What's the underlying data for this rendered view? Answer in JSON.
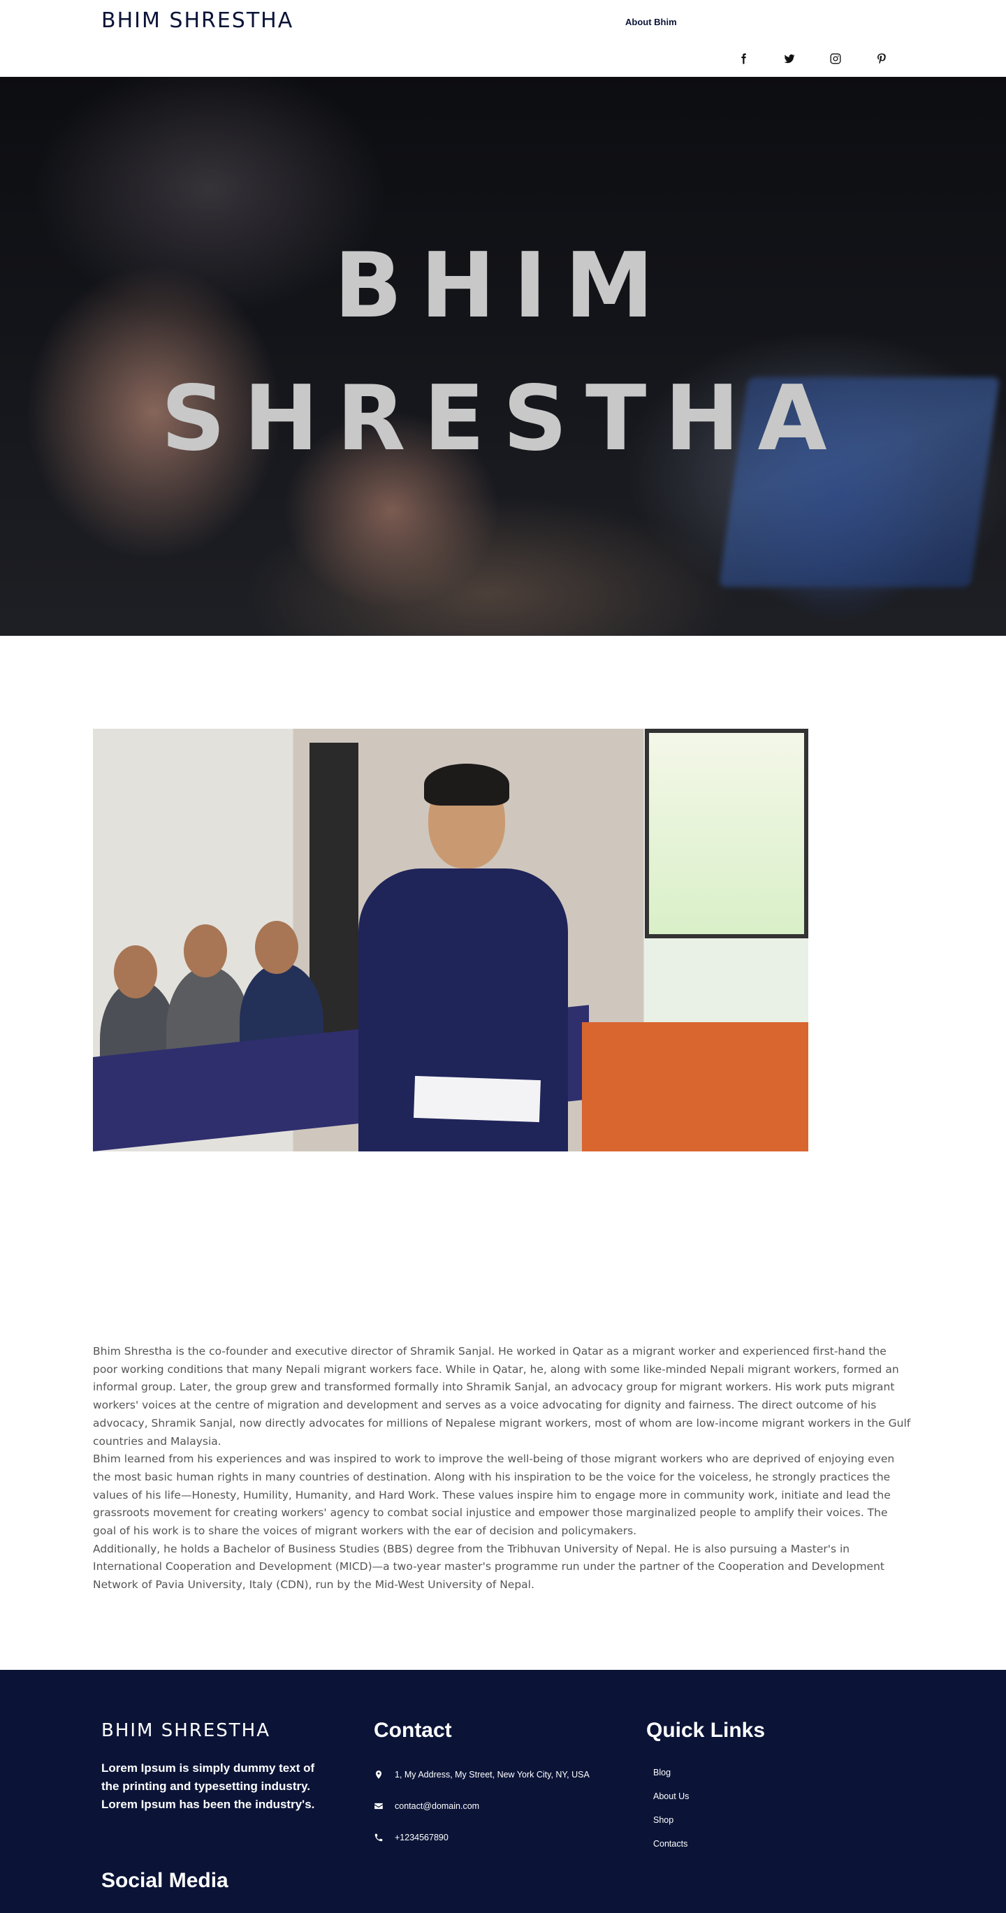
{
  "header": {
    "brand": "BHIM SHRESTHA",
    "nav": [
      {
        "label": "About Bhim"
      }
    ],
    "social": [
      "facebook-icon",
      "twitter-icon",
      "instagram-icon",
      "pinterest-icon"
    ]
  },
  "hero": {
    "line1": "BHIM",
    "line2": "SHRESTHA"
  },
  "bio": {
    "paragraphs": [
      "Bhim Shrestha is the co-founder and executive director of Shramik Sanjal. He worked in Qatar as a migrant worker and experienced first-hand the poor working conditions that many Nepali migrant workers face. While in Qatar, he, along with some like-minded Nepali migrant workers, formed an informal group. Later, the group grew and transformed formally into Shramik Sanjal, an advocacy group for migrant workers. His work puts migrant workers' voices at the centre of migration and development and serves as a voice advocating for dignity and fairness. The direct outcome of his advocacy, Shramik Sanjal, now directly advocates for millions of Nepalese migrant workers, most of whom are low-income migrant workers in the Gulf countries and Malaysia.",
      "Bhim learned from his experiences and was inspired to work to improve the well-being of those migrant workers who are deprived of enjoying even the most basic human rights in many countries of destination. Along with his inspiration to be the voice for the voiceless, he strongly practices the values of his life—Honesty, Humility, Humanity, and Hard Work. These values inspire him to engage more in community work, initiate and lead the grassroots movement for creating workers' agency to combat social injustice and empower those marginalized people to amplify their voices. The goal of his work is to share the voices of migrant workers with the ear of decision and policymakers.",
      "Additionally, he holds a Bachelor of Business Studies (BBS) degree from the Tribhuvan University of Nepal. He is also pursuing a Master's in International Cooperation and Development (MICD)—a two-year master's programme run under the partner of the Cooperation and Development Network of Pavia University, Italy (CDN), run by the Mid-West University of Nepal."
    ]
  },
  "footer": {
    "brand": "BHIM SHRESTHA",
    "description": "Lorem Ipsum is simply dummy text of the printing and typesetting industry. Lorem Ipsum has been the industry's.",
    "contact_heading": "Contact",
    "contact": {
      "address": "1, My Address, My Street, New York City, NY, USA",
      "email": "contact@domain.com",
      "phone": "+1234567890"
    },
    "links_heading": "Quick Links",
    "links": [
      "Blog",
      "About Us",
      "Shop",
      "Contacts"
    ],
    "social_heading": "Social Media"
  },
  "colors": {
    "navy": "#0b1437",
    "hero_text": "#c8c8c8"
  }
}
